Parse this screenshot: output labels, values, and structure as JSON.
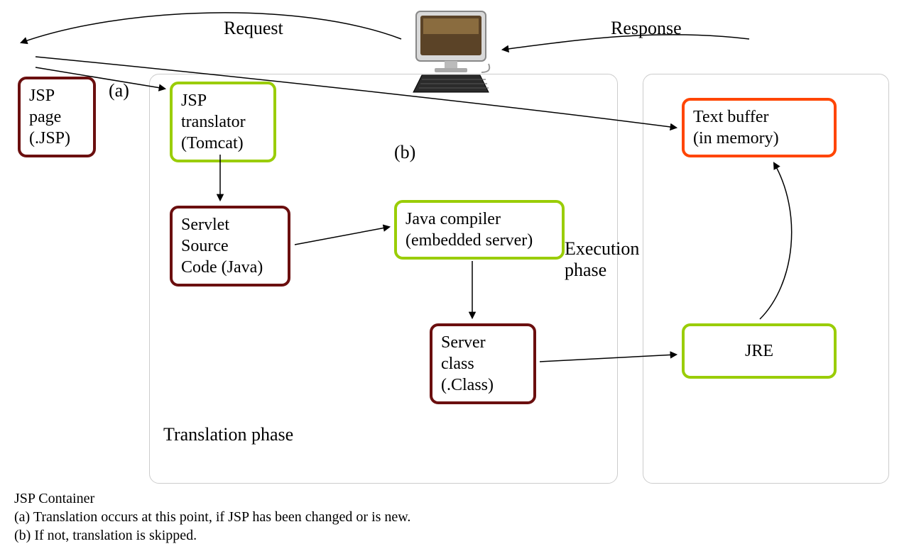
{
  "labels": {
    "request": "Request",
    "response": "Response",
    "path_a": "(a)",
    "path_b": "(b)",
    "translation_phase": "Translation phase",
    "execution_phase": "Execution\nphase"
  },
  "nodes": {
    "jsp_page": "JSP\npage\n(.JSP)",
    "jsp_translator": "JSP\ntranslator\n(Tomcat)",
    "servlet_source": "Servlet\nSource\nCode (Java)",
    "java_compiler": "Java compiler\n(embedded server)",
    "server_class": "Server\nclass\n(.Class)",
    "text_buffer": "Text buffer\n(in memory)",
    "jre": "JRE"
  },
  "footer": {
    "line1": "JSP Container",
    "line2": "(a) Translation occurs at this point, if JSP has been changed or is new.",
    "line3": "(b) If not, translation is skipped."
  },
  "colors": {
    "darkred": "#6b0f0f",
    "green": "#9acd07",
    "orange": "#ff4500",
    "phase_border": "#cccccc"
  }
}
